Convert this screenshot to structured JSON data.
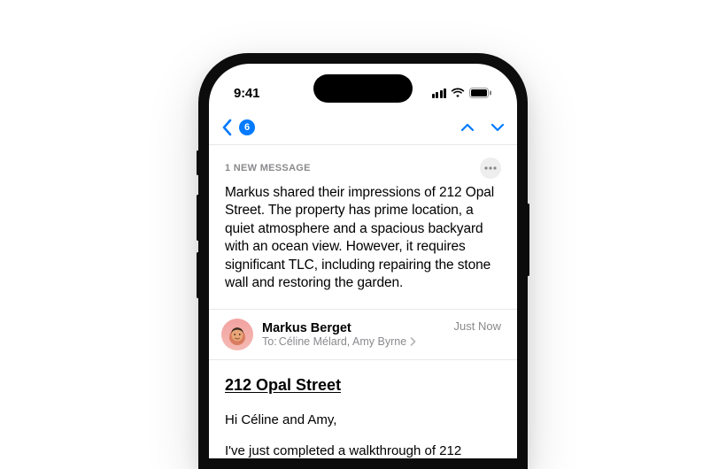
{
  "status": {
    "time": "9:41"
  },
  "nav": {
    "badge_count": "6"
  },
  "summary": {
    "label": "1 NEW MESSAGE",
    "body": "Markus shared their impressions of 212 Opal Street. The property has prime location, a quiet atmosphere and a spacious backyard with an ocean view. However, it requires significant TLC, including repairing the stone wall and restoring the garden."
  },
  "sender": {
    "name": "Markus Berget",
    "to_label": "To:",
    "recipients": "Céline Mélard, Amy Byrne",
    "timestamp": "Just Now"
  },
  "email": {
    "subject": "212 Opal Street",
    "greeting": "Hi Céline and Amy,",
    "line2": "I've just completed a walkthrough of 212"
  }
}
